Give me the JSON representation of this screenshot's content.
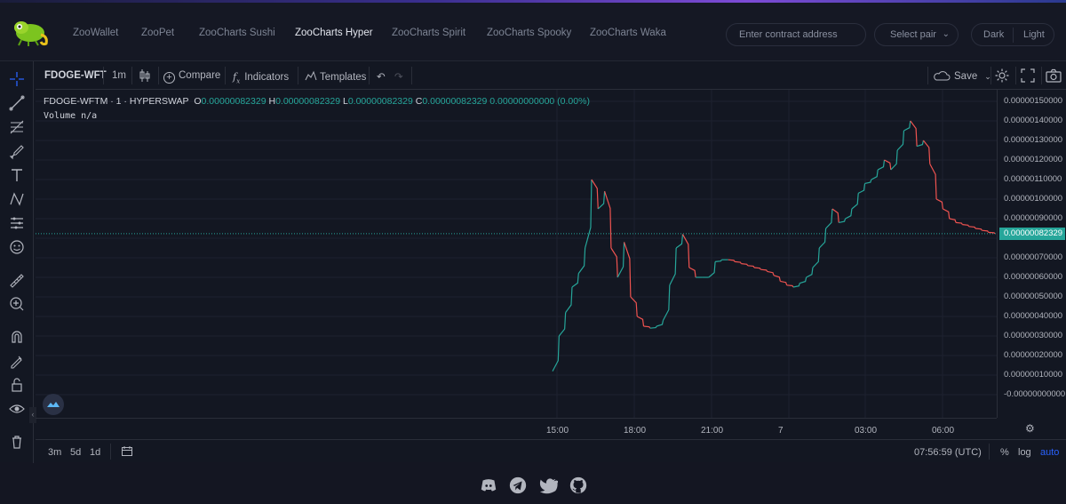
{
  "nav": {
    "links": [
      "ZooWallet",
      "ZooPet",
      "ZooCharts Sushi",
      "ZooCharts Hyper",
      "ZooCharts Spirit",
      "ZooCharts Spooky",
      "ZooCharts Waka"
    ],
    "active": "ZooCharts Hyper",
    "contract_placeholder": "Enter contract address",
    "pair_label": "Select pair",
    "theme_dark": "Dark",
    "theme_light": "Light"
  },
  "toolbar": {
    "symbol": "FDOGE-WFT",
    "interval": "1m",
    "compare": "Compare",
    "indicators": "Indicators",
    "templates": "Templates",
    "save": "Save"
  },
  "legend": {
    "title": "FDOGE-WFTM · 1 · HYPERSWAP",
    "o_label": "O",
    "o_value": "0.00000082329",
    "h_label": "H",
    "h_value": "0.00000082329",
    "l_label": "L",
    "l_value": "0.00000082329",
    "c_label": "C",
    "c_value": "0.00000082329",
    "change": "0.00000000000 (0.00%)",
    "volume": "Volume  n/a"
  },
  "price_axis": {
    "ticks": [
      "0.00000150000",
      "0.00000140000",
      "0.00000130000",
      "0.00000120000",
      "0.00000110000",
      "0.00000100000",
      "0.00000090000",
      "0.00000080000",
      "0.00000070000",
      "0.00000060000",
      "0.00000050000",
      "0.00000040000",
      "0.00000030000",
      "0.00000020000",
      "0.00000010000",
      "-0.00000000000"
    ],
    "current": "0.00000082329"
  },
  "time_axis": {
    "ticks": [
      "15:00",
      "18:00",
      "21:00",
      "7",
      "03:00",
      "06:00"
    ]
  },
  "bottom_bar": {
    "ranges": [
      "3m",
      "5d",
      "1d"
    ],
    "clock": "07:56:59 (UTC)",
    "percent": "%",
    "log": "log",
    "auto": "auto"
  },
  "colors": {
    "up": "#26a69a",
    "down": "#ef5350",
    "accent": "#2962ff"
  },
  "chart_data": {
    "type": "line",
    "title": "",
    "ylim": [
      0,
      1.5e-06
    ],
    "x": [
      "14:55",
      "15:10",
      "15:25",
      "15:40",
      "15:55",
      "16:10",
      "16:25",
      "16:40",
      "16:55",
      "17:10",
      "17:25",
      "17:40",
      "17:55",
      "18:10",
      "18:25",
      "18:40",
      "18:55",
      "19:10",
      "19:25",
      "19:40",
      "19:55",
      "20:10",
      "20:25",
      "20:40",
      "20:55",
      "21:10",
      "21:25",
      "21:40",
      "21:55",
      "22:10",
      "22:25",
      "22:40",
      "22:55",
      "23:10",
      "23:25",
      "23:40",
      "23:55",
      "00:10",
      "00:25",
      "00:40",
      "00:55",
      "01:10",
      "01:25",
      "01:40",
      "01:55",
      "02:10",
      "02:25",
      "02:40",
      "02:55",
      "03:10",
      "03:25",
      "03:40",
      "03:55",
      "04:10",
      "04:25",
      "04:40",
      "04:55",
      "05:10",
      "05:25",
      "05:40",
      "05:55",
      "06:10",
      "06:25",
      "06:40",
      "06:55",
      "07:10",
      "07:25",
      "07:40",
      "07:55"
    ],
    "series": [
      {
        "values": [
          1.2e-07,
          3e-07,
          4.2e-07,
          5.5e-07,
          6.2e-07,
          7.5e-07,
          1.1e-06,
          9.5e-07,
          1.04e-06,
          7.5e-07,
          6e-07,
          7.8e-07,
          5e-07,
          4e-07,
          3.5e-07,
          3.4e-07,
          3.5e-07,
          3.8e-07,
          5.6e-07,
          7.5e-07,
          8.2e-07,
          6.5e-07,
          6e-07,
          6e-07,
          6e-07,
          6.8e-07,
          6.9e-07,
          6.9e-07,
          6.8e-07,
          6.7e-07,
          6.6e-07,
          6.5e-07,
          6.4e-07,
          6.3e-07,
          6.1e-07,
          5.8e-07,
          5.6e-07,
          5.5e-07,
          5.7e-07,
          6e-07,
          6.5e-07,
          7.5e-07,
          8.5e-07,
          9.5e-07,
          8.8e-07,
          9e-07,
          9.5e-07,
          1.03e-06,
          1.08e-06,
          1.1e-06,
          1.15e-06,
          1.2e-06,
          1.15e-06,
          1.25e-06,
          1.35e-06,
          1.4e-06,
          1.27e-06,
          1.3e-06,
          1.18e-06,
          1e-06,
          9.5e-07,
          9e-07,
          8.8e-07,
          8.7e-07,
          8.6e-07,
          8.5e-07,
          8.4e-07,
          8.3e-07,
          8.2329e-07
        ]
      }
    ]
  }
}
